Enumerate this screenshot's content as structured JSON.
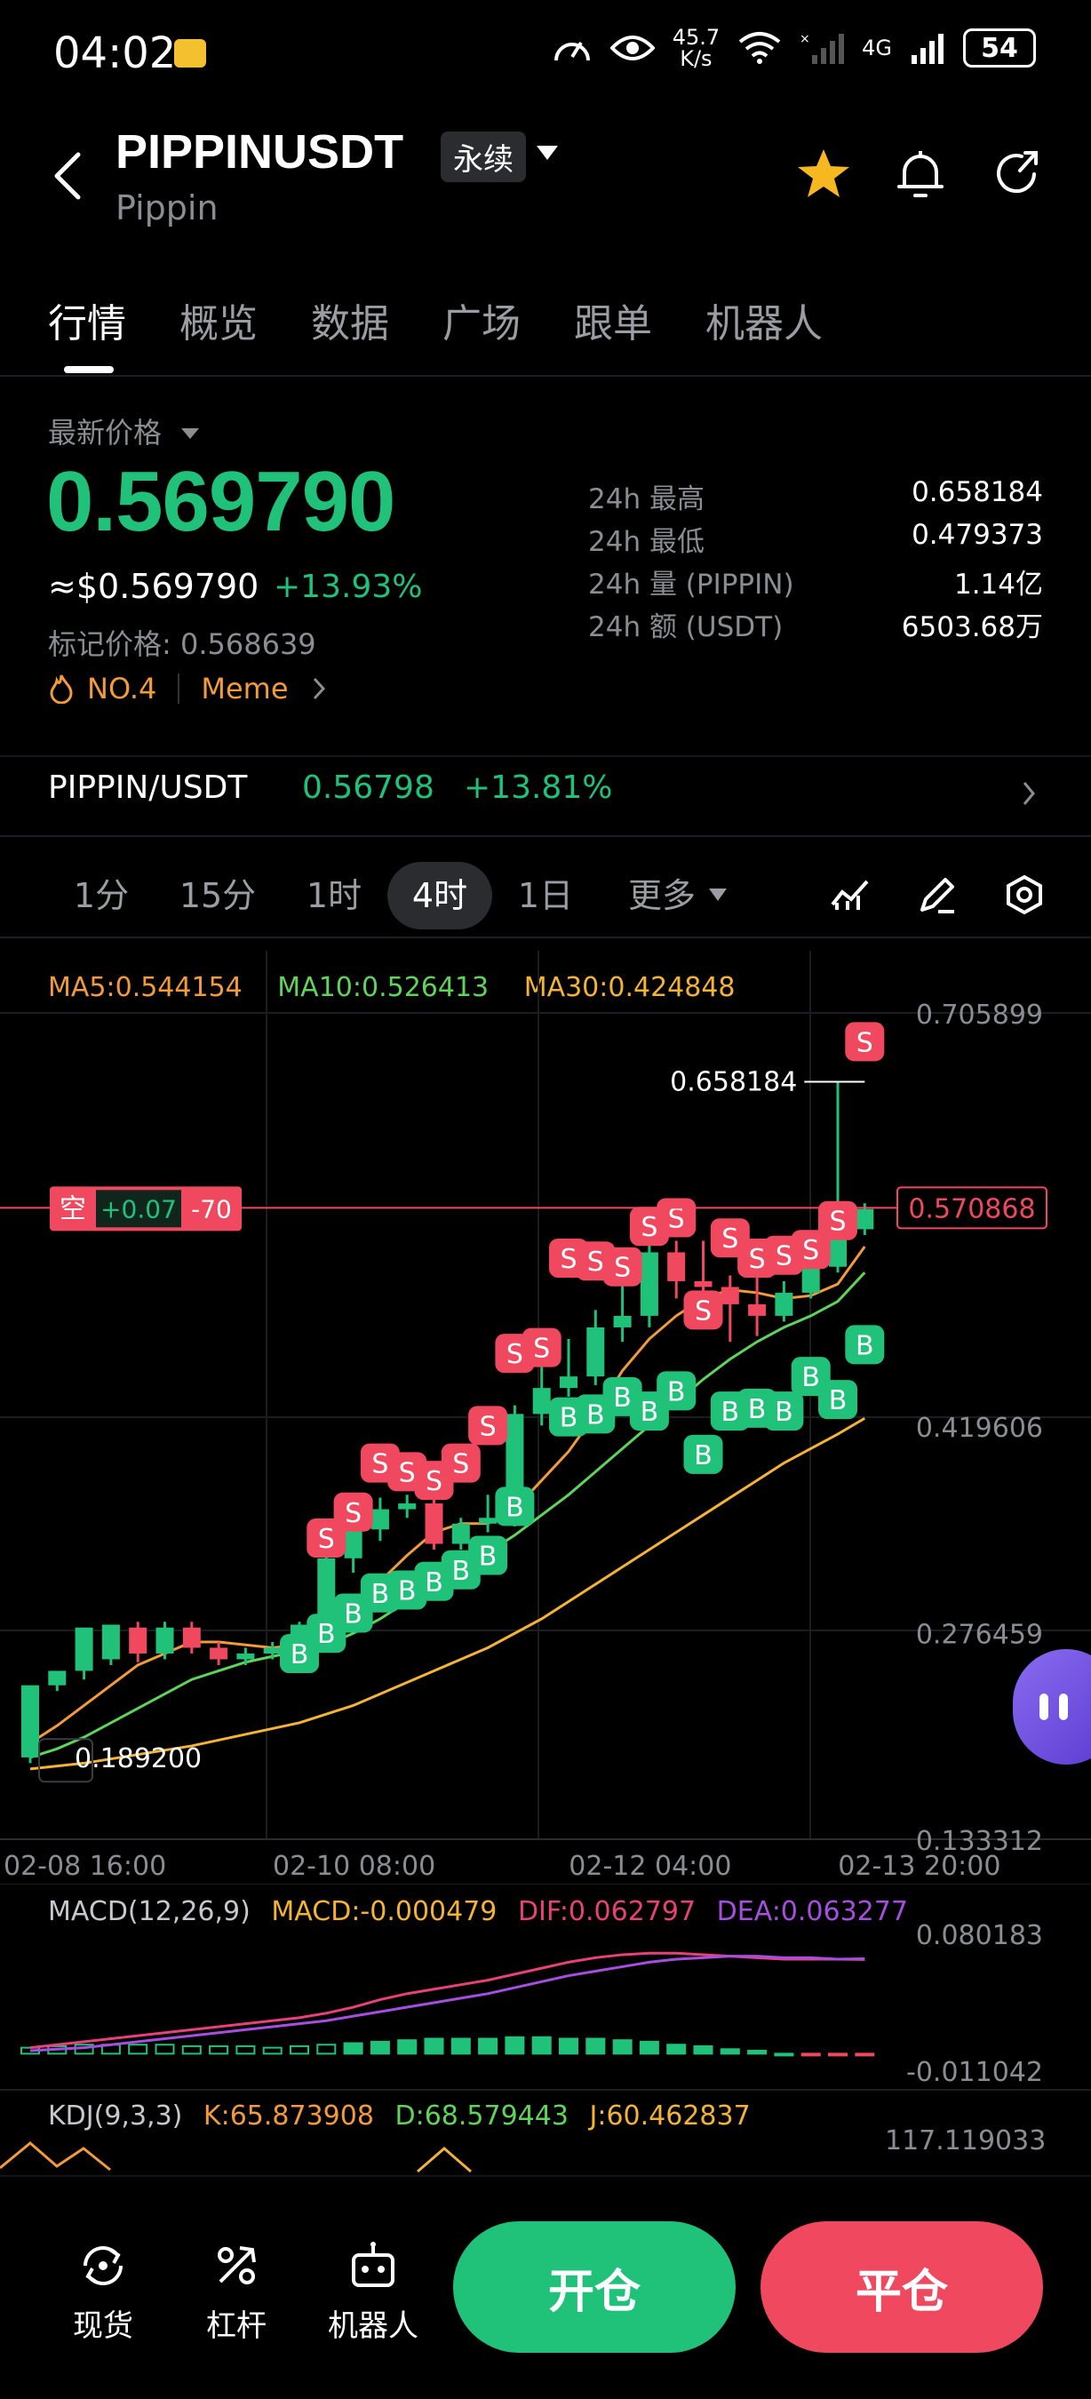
{
  "status_bar": {
    "time": "04:02",
    "net_speed_top": "45.7",
    "net_speed_bottom": "K/s",
    "network": "4G",
    "battery": "54"
  },
  "header": {
    "symbol": "PIPPINUSDT",
    "contract_type": "永续",
    "name": "Pippin"
  },
  "tabs": [
    {
      "label": "行情",
      "active": true
    },
    {
      "label": "概览"
    },
    {
      "label": "数据"
    },
    {
      "label": "广场"
    },
    {
      "label": "跟单"
    },
    {
      "label": "机器人"
    }
  ],
  "price": {
    "label": "最新价格",
    "last": "0.569790",
    "usd": "≈$0.569790",
    "change": "+13.93%",
    "mark_label": "标记价格: ",
    "mark": "0.568639",
    "rank": "NO.4",
    "category": "Meme"
  },
  "stats": [
    {
      "label": "24h  最高",
      "value": "0.658184"
    },
    {
      "label": "24h  最低",
      "value": "0.479373"
    },
    {
      "label": "24h  量 (PIPPIN)",
      "value": "1.14亿"
    },
    {
      "label": "24h  额 (USDT)",
      "value": "6503.68万"
    }
  ],
  "spot": {
    "pair": "PIPPIN/USDT",
    "price": "0.56798",
    "change": "+13.81%"
  },
  "intervals": [
    {
      "label": "1分"
    },
    {
      "label": "15分"
    },
    {
      "label": "1时"
    },
    {
      "label": "4时",
      "active": true
    },
    {
      "label": "1日"
    },
    {
      "label": "更多"
    }
  ],
  "colors": {
    "up": "#20c27a",
    "down": "#f0485e",
    "ma5": "#f39a3a",
    "ma10": "#5fd35a",
    "ma30": "#f5b335",
    "dif": "#e8407a",
    "dea": "#a64ee0"
  },
  "chart_data": {
    "type": "candlestick",
    "ma_legend": {
      "ma5": "MA5:0.544154",
      "ma10": "MA10:0.526413",
      "ma30": "MA30:0.424848"
    },
    "y_ticks": [
      "0.705899",
      "0.419606",
      "0.276459",
      "0.133312"
    ],
    "y_tick_values": [
      0.705899,
      0.419606,
      0.276459,
      0.133312
    ],
    "x_ticks": [
      "02-08 16:00",
      "02-10 08:00",
      "02-12 04:00",
      "02-13 20:00"
    ],
    "x_tick_index": [
      0,
      10,
      21,
      31
    ],
    "high_label": "0.658184",
    "high_value": 0.658184,
    "low_label": "0.189200",
    "low_value": 0.1892,
    "current_price_label": "0.570868",
    "current_price": 0.570868,
    "position": {
      "side": "空",
      "pnl": "+0.07",
      "qty": "-70"
    },
    "candles": [
      [
        0.19,
        0.24,
        0.192,
        0.186
      ],
      [
        0.24,
        0.25,
        0.25,
        0.236
      ],
      [
        0.25,
        0.28,
        0.258,
        0.244
      ],
      [
        0.258,
        0.282,
        0.28,
        0.254
      ],
      [
        0.28,
        0.262,
        0.284,
        0.256
      ],
      [
        0.262,
        0.28,
        0.284,
        0.258
      ],
      [
        0.28,
        0.266,
        0.284,
        0.262
      ],
      [
        0.266,
        0.258,
        0.27,
        0.254
      ],
      [
        0.258,
        0.262,
        0.266,
        0.254
      ],
      [
        0.262,
        0.266,
        0.27,
        0.258
      ],
      [
        0.266,
        0.282,
        0.284,
        0.262
      ],
      [
        0.282,
        0.328,
        0.332,
        0.278
      ],
      [
        0.328,
        0.348,
        0.356,
        0.318
      ],
      [
        0.348,
        0.362,
        0.37,
        0.34
      ],
      [
        0.362,
        0.366,
        0.372,
        0.356
      ],
      [
        0.366,
        0.338,
        0.37,
        0.334
      ],
      [
        0.338,
        0.352,
        0.356,
        0.334
      ],
      [
        0.352,
        0.356,
        0.372,
        0.346
      ],
      [
        0.356,
        0.428,
        0.434,
        0.35
      ],
      [
        0.428,
        0.446,
        0.476,
        0.42
      ],
      [
        0.446,
        0.454,
        0.48,
        0.44
      ],
      [
        0.454,
        0.488,
        0.5,
        0.448
      ],
      [
        0.488,
        0.496,
        0.532,
        0.478
      ],
      [
        0.496,
        0.54,
        0.546,
        0.488
      ],
      [
        0.54,
        0.52,
        0.548,
        0.508
      ],
      [
        0.52,
        0.516,
        0.548,
        0.51
      ],
      [
        0.516,
        0.504,
        0.524,
        0.478
      ],
      [
        0.504,
        0.496,
        0.526,
        0.482
      ],
      [
        0.496,
        0.512,
        0.52,
        0.492
      ],
      [
        0.512,
        0.53,
        0.54,
        0.508
      ],
      [
        0.53,
        0.556,
        0.658,
        0.526
      ],
      [
        0.556,
        0.57,
        0.574,
        0.552
      ]
    ],
    "ma5": [
      0.2,
      0.212,
      0.226,
      0.24,
      0.254,
      0.262,
      0.27,
      0.27,
      0.268,
      0.266,
      0.268,
      0.276,
      0.292,
      0.312,
      0.33,
      0.346,
      0.352,
      0.352,
      0.362,
      0.382,
      0.402,
      0.428,
      0.458,
      0.48,
      0.496,
      0.508,
      0.514,
      0.512,
      0.508,
      0.51,
      0.518,
      0.544
    ],
    "ma10": [
      0.19,
      0.196,
      0.204,
      0.214,
      0.224,
      0.234,
      0.244,
      0.25,
      0.256,
      0.26,
      0.264,
      0.268,
      0.276,
      0.286,
      0.298,
      0.31,
      0.322,
      0.332,
      0.344,
      0.358,
      0.372,
      0.388,
      0.404,
      0.42,
      0.436,
      0.452,
      0.466,
      0.478,
      0.488,
      0.496,
      0.506,
      0.526
    ],
    "ma30": [
      0.182,
      0.184,
      0.186,
      0.189,
      0.192,
      0.195,
      0.198,
      0.202,
      0.206,
      0.21,
      0.214,
      0.22,
      0.226,
      0.234,
      0.242,
      0.25,
      0.258,
      0.266,
      0.276,
      0.286,
      0.298,
      0.31,
      0.322,
      0.334,
      0.346,
      0.358,
      0.37,
      0.382,
      0.394,
      0.404,
      0.414,
      0.425
    ],
    "signals": [
      {
        "i": 10,
        "t": "B",
        "p": 0.262
      },
      {
        "i": 11,
        "t": "S",
        "p": 0.342
      },
      {
        "i": 11,
        "t": "B",
        "p": 0.276
      },
      {
        "i": 12,
        "t": "B",
        "p": 0.29
      },
      {
        "i": 12,
        "t": "S",
        "p": 0.36
      },
      {
        "i": 13,
        "t": "B",
        "p": 0.304
      },
      {
        "i": 13,
        "t": "S",
        "p": 0.394
      },
      {
        "i": 14,
        "t": "B",
        "p": 0.306
      },
      {
        "i": 14,
        "t": "S",
        "p": 0.388
      },
      {
        "i": 15,
        "t": "B",
        "p": 0.312
      },
      {
        "i": 15,
        "t": "S",
        "p": 0.382
      },
      {
        "i": 16,
        "t": "B",
        "p": 0.32
      },
      {
        "i": 16,
        "t": "S",
        "p": 0.394
      },
      {
        "i": 17,
        "t": "B",
        "p": 0.33
      },
      {
        "i": 17,
        "t": "S",
        "p": 0.42
      },
      {
        "i": 18,
        "t": "B",
        "p": 0.364
      },
      {
        "i": 18,
        "t": "S",
        "p": 0.47
      },
      {
        "i": 19,
        "t": "S",
        "p": 0.474
      },
      {
        "i": 20,
        "t": "B",
        "p": 0.426
      },
      {
        "i": 20,
        "t": "S",
        "p": 0.536
      },
      {
        "i": 21,
        "t": "S",
        "p": 0.534
      },
      {
        "i": 21,
        "t": "B",
        "p": 0.428
      },
      {
        "i": 22,
        "t": "S",
        "p": 0.53
      },
      {
        "i": 22,
        "t": "B",
        "p": 0.44
      },
      {
        "i": 23,
        "t": "S",
        "p": 0.558
      },
      {
        "i": 23,
        "t": "B",
        "p": 0.43
      },
      {
        "i": 24,
        "t": "S",
        "p": 0.564
      },
      {
        "i": 24,
        "t": "B",
        "p": 0.444
      },
      {
        "i": 25,
        "t": "S",
        "p": 0.5
      },
      {
        "i": 25,
        "t": "B",
        "p": 0.4
      },
      {
        "i": 26,
        "t": "S",
        "p": 0.55
      },
      {
        "i": 26,
        "t": "B",
        "p": 0.43
      },
      {
        "i": 27,
        "t": "S",
        "p": 0.536
      },
      {
        "i": 27,
        "t": "B",
        "p": 0.432
      },
      {
        "i": 28,
        "t": "S",
        "p": 0.538
      },
      {
        "i": 28,
        "t": "B",
        "p": 0.43
      },
      {
        "i": 29,
        "t": "S",
        "p": 0.542
      },
      {
        "i": 29,
        "t": "B",
        "p": 0.454
      },
      {
        "i": 30,
        "t": "S",
        "p": 0.562
      },
      {
        "i": 30,
        "t": "B",
        "p": 0.438
      },
      {
        "i": 31,
        "t": "S",
        "p": 0.686
      },
      {
        "i": 31,
        "t": "B",
        "p": 0.476
      }
    ]
  },
  "macd_data": {
    "legend_name": "MACD(12,26,9)",
    "macd": "MACD:-0.000479",
    "dif": "DIF:0.062797",
    "dea": "DEA:0.063277",
    "y_ticks": [
      "0.080183",
      "-0.011042"
    ],
    "y_max": 0.080183,
    "y_min": -0.011042,
    "hist": [
      0.004,
      0.005,
      0.006,
      0.006,
      0.006,
      0.006,
      0.005,
      0.005,
      0.005,
      0.004,
      0.005,
      0.006,
      0.007,
      0.008,
      0.009,
      0.01,
      0.01,
      0.01,
      0.011,
      0.011,
      0.01,
      0.01,
      0.009,
      0.008,
      0.006,
      0.005,
      0.003,
      0.002,
      0.0,
      -0.001,
      -0.001,
      -0.000479
    ],
    "dif_line": [
      0.004,
      0.006,
      0.008,
      0.01,
      0.012,
      0.014,
      0.016,
      0.018,
      0.02,
      0.022,
      0.024,
      0.027,
      0.031,
      0.036,
      0.04,
      0.043,
      0.046,
      0.049,
      0.053,
      0.057,
      0.061,
      0.064,
      0.066,
      0.067,
      0.067,
      0.066,
      0.065,
      0.064,
      0.063,
      0.063,
      0.063,
      0.0628
    ],
    "dea_line": [
      0.002,
      0.003,
      0.004,
      0.006,
      0.008,
      0.01,
      0.012,
      0.014,
      0.016,
      0.018,
      0.02,
      0.022,
      0.025,
      0.028,
      0.031,
      0.034,
      0.037,
      0.04,
      0.044,
      0.048,
      0.052,
      0.055,
      0.058,
      0.061,
      0.063,
      0.064,
      0.065,
      0.065,
      0.064,
      0.064,
      0.063,
      0.0633
    ]
  },
  "kdj": {
    "name": "KDJ(9,3,3)",
    "k": "K:65.873908",
    "d": "D:68.579443",
    "j": "J:60.462837",
    "y_top": "117.119033"
  },
  "bottom_nav": [
    {
      "label": "现货",
      "icon": "spot-icon"
    },
    {
      "label": "杠杆",
      "icon": "leverage-icon"
    },
    {
      "label": "机器人",
      "icon": "robot-icon"
    }
  ],
  "actions": {
    "open": "开仓",
    "close": "平仓"
  }
}
